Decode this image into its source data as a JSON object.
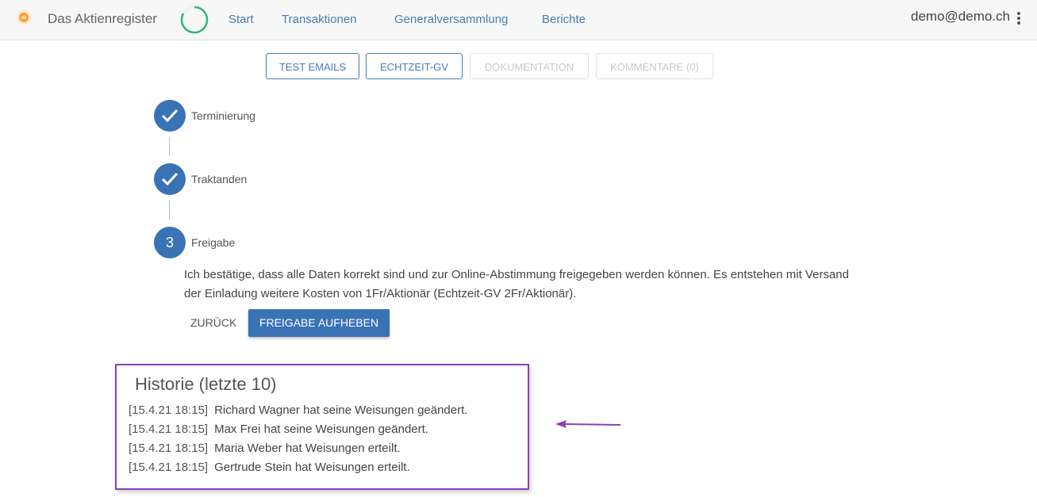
{
  "header": {
    "brand": "Das Aktienregister",
    "nav": [
      "Start",
      "Transaktionen",
      "Generalversammlung",
      "Berichte"
    ],
    "user": "demo@demo.ch"
  },
  "toolbar": {
    "buttons": [
      {
        "label": "TEST EMAILS",
        "enabled": true
      },
      {
        "label": "ECHTZEIT-GV",
        "enabled": true
      },
      {
        "label": "DOKUMENTATION",
        "enabled": false
      },
      {
        "label": "KOMMENTARE (0)",
        "enabled": false
      }
    ]
  },
  "stepper": {
    "steps": [
      {
        "label": "Terminierung",
        "state": "done"
      },
      {
        "label": "Traktanden",
        "state": "done"
      },
      {
        "label": "Freigabe",
        "state": "active",
        "number": "3"
      }
    ]
  },
  "release": {
    "text": "Ich bestätige, dass alle Daten korrekt sind und zur Online-Abstimmung freigegeben werden können. Es entstehen mit Versand der Einladung weitere Kosten von 1Fr/Aktionär (Echtzeit-GV 2Fr/Aktionär).",
    "back_label": "ZURÜCK",
    "primary_label": "FREIGABE AUFHEBEN"
  },
  "history": {
    "title": "Historie (letzte 10)",
    "entries": [
      {
        "time": "[15.4.21 18:15]",
        "text": "Richard Wagner hat seine Weisungen geändert."
      },
      {
        "time": "[15.4.21 18:15]",
        "text": "Max Frei hat seine Weisungen geändert."
      },
      {
        "time": "[15.4.21 18:15]",
        "text": "Maria Weber hat Weisungen erteilt."
      },
      {
        "time": "[15.4.21 18:15]",
        "text": "Gertrude Stein hat Weisungen erteilt."
      }
    ]
  },
  "colors": {
    "primary": "#3a73b5",
    "link": "#4a7bb0",
    "highlight": "#8b3fb4",
    "spinner": "#2fb77a"
  },
  "icons": [
    "sun-logo-icon",
    "spinner-icon",
    "more-vert-icon",
    "check-icon",
    "arrow-left-icon"
  ]
}
